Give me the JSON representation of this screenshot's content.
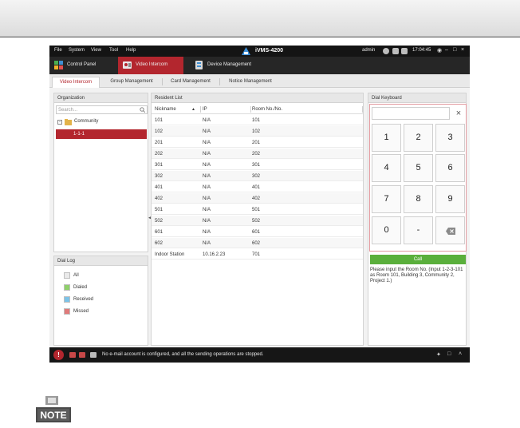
{
  "menubar": {
    "items": [
      "File",
      "System",
      "View",
      "Tool",
      "Help"
    ],
    "app_title": "iVMS-4200",
    "user": "admin",
    "clock": "17:04:45"
  },
  "modules": [
    {
      "label": "Control Panel"
    },
    {
      "label": "Video Intercom"
    },
    {
      "label": "Device Management"
    }
  ],
  "tabs": [
    "Video Intercom",
    "Group Management",
    "Card Management",
    "Notice Management"
  ],
  "organization": {
    "title": "Organization",
    "search_placeholder": "Search...",
    "tree_root": "Community",
    "tree_node": "1-1-1"
  },
  "dial_log": {
    "title": "Dial Log",
    "items": [
      "All",
      "Dialed",
      "Received",
      "Missed"
    ]
  },
  "resident_list": {
    "title": "Resident List",
    "columns": [
      "Nickname",
      "IP",
      "Room No./No."
    ],
    "rows": [
      {
        "nickname": "101",
        "ip": "N/A",
        "room": "101"
      },
      {
        "nickname": "102",
        "ip": "N/A",
        "room": "102"
      },
      {
        "nickname": "201",
        "ip": "N/A",
        "room": "201"
      },
      {
        "nickname": "202",
        "ip": "N/A",
        "room": "202"
      },
      {
        "nickname": "301",
        "ip": "N/A",
        "room": "301"
      },
      {
        "nickname": "302",
        "ip": "N/A",
        "room": "302"
      },
      {
        "nickname": "401",
        "ip": "N/A",
        "room": "401"
      },
      {
        "nickname": "402",
        "ip": "N/A",
        "room": "402"
      },
      {
        "nickname": "501",
        "ip": "N/A",
        "room": "501"
      },
      {
        "nickname": "502",
        "ip": "N/A",
        "room": "502"
      },
      {
        "nickname": "601",
        "ip": "N/A",
        "room": "601"
      },
      {
        "nickname": "602",
        "ip": "N/A",
        "room": "602"
      },
      {
        "nickname": "Indoor Station",
        "ip": "10.16.2.23",
        "room": "701"
      }
    ]
  },
  "dial_keyboard": {
    "title": "Dial Keyboard",
    "keys": [
      "1",
      "2",
      "3",
      "4",
      "5",
      "6",
      "7",
      "8",
      "9",
      "0",
      "-"
    ],
    "call_label": "Call",
    "hint": "Please input the Room No. (Input 1-2-3-101 as Room 101, Building 3, Community 2, Project 1.)"
  },
  "status_bar": {
    "message": "No e-mail account is configured, and all the sending operations are stopped."
  },
  "colors": {
    "accent": "#b3262e",
    "call_green": "#5aaf3c"
  }
}
